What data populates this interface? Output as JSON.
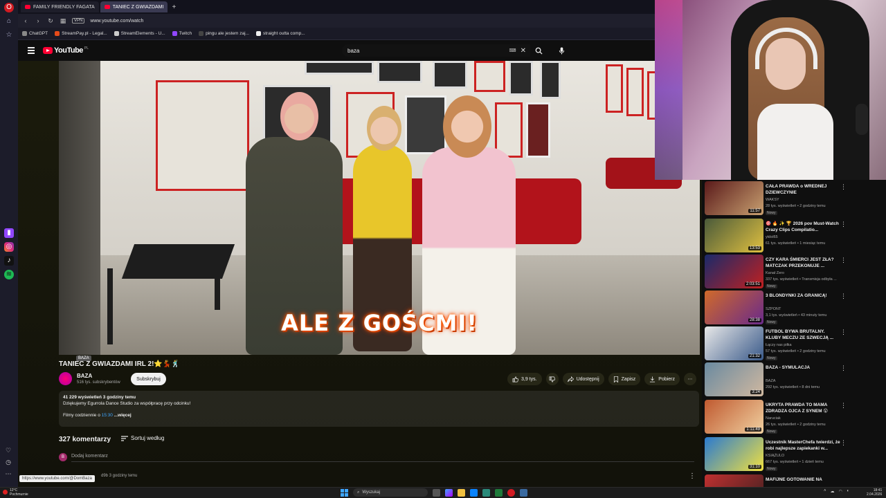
{
  "browser": {
    "tabs": [
      {
        "label": "FAMILY FRIENDLY FAGATA"
      },
      {
        "label": "TANIEC Z GWIAZDAMI"
      }
    ],
    "url": "www.youtube.com/watch",
    "vpn": "VPN",
    "bookmarks": [
      "ChatGPT",
      "StreamPay.pl - Legal...",
      "StreamElements - U...",
      "Twitch",
      "pingu ale jestem zaj...",
      "straight outta comp..."
    ]
  },
  "youtube": {
    "logo": "YouTube",
    "country": "PL",
    "search_value": "baza"
  },
  "video": {
    "caption_overlay": "ALE Z GOŚCMI!",
    "tooltip": "BAZA",
    "title": "TANIEC Z GWIAZDAMI IRL 2!⭐💃🕺",
    "channel": "BAZA",
    "subscribers": "516 tys. subskrybentów",
    "subscribe_label": "Subskrybuj",
    "likes": "3,9 tys.",
    "share_label": "Udostępnij",
    "save_label": "Zapisz",
    "download_label": "Pobierz",
    "more_label": "⋯",
    "description": {
      "stats": "41 229 wyświetleń  3 godziny temu",
      "line1": "Dziękujemy Egurrola Dance Studio za współpracę przy odcinku!",
      "line3_prefix": "Filmy codziennie o ",
      "line3_time": "15:30",
      "more": " ...więcej"
    }
  },
  "comments": {
    "count": "327 komentarzy",
    "sort_label": "Sortuj według",
    "add_avatar": "B",
    "add_placeholder": "Dodaj komentarz",
    "first_meta": "d9b  3 godziny temu"
  },
  "status_url": "https://www.youtube.com/@DomBaza",
  "recommendations": [
    {
      "title": "CAŁA PRAWDA o WREDNEJ DZIEWCZYNIE",
      "channel": "WAKSY",
      "meta": "28 tys. wyświetleń • 2 godziny temu",
      "badge": "Nowy",
      "duration": "11:57",
      "c1": "#5a1a1a",
      "c2": "#c8a070"
    },
    {
      "title": "🎯 🔥 ✨ 🏆 2026 pov Must-Watch Crazy Clips Compilatio...",
      "channel": "ytdol65",
      "meta": "61 tys. wyświetleń • 1 miesiąc temu",
      "badge": "",
      "duration": "13:53",
      "c1": "#4a5a3a",
      "c2": "#e0c040"
    },
    {
      "title": "CZY KARA ŚMIERCI JEST ZŁA? MATCZAK PRZEKONUJE ...",
      "channel": "Kanał Zero",
      "meta": "337 tys. wyświetleń • Transmisja odbyła ...",
      "badge": "Nowy",
      "duration": "2:03:51",
      "c1": "#1a2a6a",
      "c2": "#c02020"
    },
    {
      "title": "3 BLONDYNKI ZA GRANICĄ!",
      "channel": "SZPONT",
      "meta": "3,1 tys. wyświetleń • 43 minuty temu",
      "badge": "Nowy",
      "duration": "28:38",
      "c1": "#d06a2a",
      "c2": "#6a2a8a"
    },
    {
      "title": "FUTBOL BYWA BRUTALNY. KLUBY MECZU ZE SZWECJĄ ...",
      "channel": "Łączy nas piłka",
      "meta": "57 tys. wyświetleń • 2 godziny temu",
      "badge": "Nowy",
      "duration": "21:32",
      "c1": "#e8e8e8",
      "c2": "#3a5a8a"
    },
    {
      "title": "BAZA - SYMULACJA",
      "channel": "BAZA",
      "meta": "292 tys. wyświetleń • 8 dni temu",
      "badge": "",
      "duration": "3:24",
      "c1": "#6a8aa0",
      "c2": "#d0b8a0"
    },
    {
      "title": "UKRYTA PRAWDA TO MAMA ZDRADZA OJCA Z SYNEM 😮",
      "channel": "Naruciak",
      "meta": "26 tys. wyświetleń • 2 godziny temu",
      "badge": "Nowy",
      "duration": "1:11:49",
      "c1": "#c05a30",
      "c2": "#f0d0a0"
    },
    {
      "title": "Uczestnik MasterChefa twierdzi, że robi najlepsze zapiekanki w...",
      "channel": "KSIĄŻULO",
      "meta": "667 tys. wyświetleń • 1 dzień temu",
      "badge": "Nowy",
      "duration": "31:10",
      "c1": "#2a7ad0",
      "c2": "#f0e040"
    },
    {
      "title": "MAFIJNE GOTOWANIE NA",
      "channel": "",
      "meta": "",
      "badge": "",
      "duration": "",
      "c1": "#c03030",
      "c2": "#402020"
    }
  ],
  "taskbar": {
    "weather_temp": "12°C",
    "weather_desc": "Pochmurnie",
    "search_placeholder": "Wyszukaj",
    "time": "18:41",
    "date": "2.04.2026"
  },
  "colors": {
    "accent": "#ff0033",
    "link": "#3ea6ff",
    "background": "#0f0f0f"
  }
}
